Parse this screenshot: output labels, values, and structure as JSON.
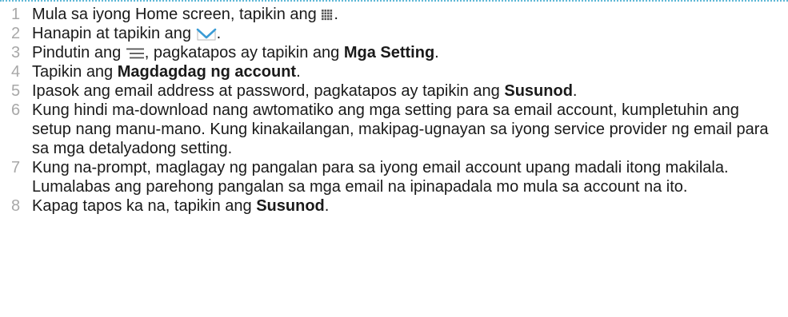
{
  "steps": [
    {
      "number": "1",
      "parts": [
        {
          "text": "Mula sa iyong Home screen, tapikin ang "
        },
        {
          "icon": "apps-grid-icon"
        },
        {
          "text": "."
        }
      ]
    },
    {
      "number": "2",
      "parts": [
        {
          "text": "Hanapin at tapikin ang "
        },
        {
          "icon": "email-envelope-icon"
        },
        {
          "text": "."
        }
      ]
    },
    {
      "number": "3",
      "parts": [
        {
          "text": "Pindutin ang "
        },
        {
          "icon": "menu-icon"
        },
        {
          "text": ", pagkatapos ay tapikin ang "
        },
        {
          "bold": "Mga Setting"
        },
        {
          "text": "."
        }
      ]
    },
    {
      "number": "4",
      "parts": [
        {
          "text": "Tapikin ang "
        },
        {
          "bold": "Magdagdag ng account"
        },
        {
          "text": "."
        }
      ]
    },
    {
      "number": "5",
      "parts": [
        {
          "text": "Ipasok ang email address at password, pagkatapos ay tapikin ang "
        },
        {
          "bold": "Susunod"
        },
        {
          "text": "."
        }
      ]
    },
    {
      "number": "6",
      "parts": [
        {
          "text": "Kung hindi ma-download nang awtomatiko ang mga setting para sa email account, kumpletuhin ang setup nang manu-mano. Kung kinakailangan, makipag-ugnayan sa iyong service provider ng email para sa mga detalyadong setting."
        }
      ]
    },
    {
      "number": "7",
      "parts": [
        {
          "text": "Kung na-prompt, maglagay ng pangalan para sa iyong email account upang madali itong makilala. Lumalabas ang parehong pangalan sa mga email na ipinapadala mo mula sa account na ito."
        }
      ]
    },
    {
      "number": "8",
      "parts": [
        {
          "text": "Kapag tapos ka na, tapikin ang "
        },
        {
          "bold": "Susunod"
        },
        {
          "text": "."
        }
      ]
    }
  ],
  "colors": {
    "text": "#1a1a1a",
    "step_number": "#a8a8a8",
    "icon_grey": "#555555",
    "envelope_blue": "#3a9bd5",
    "top_rule": "#5fb8d6"
  }
}
